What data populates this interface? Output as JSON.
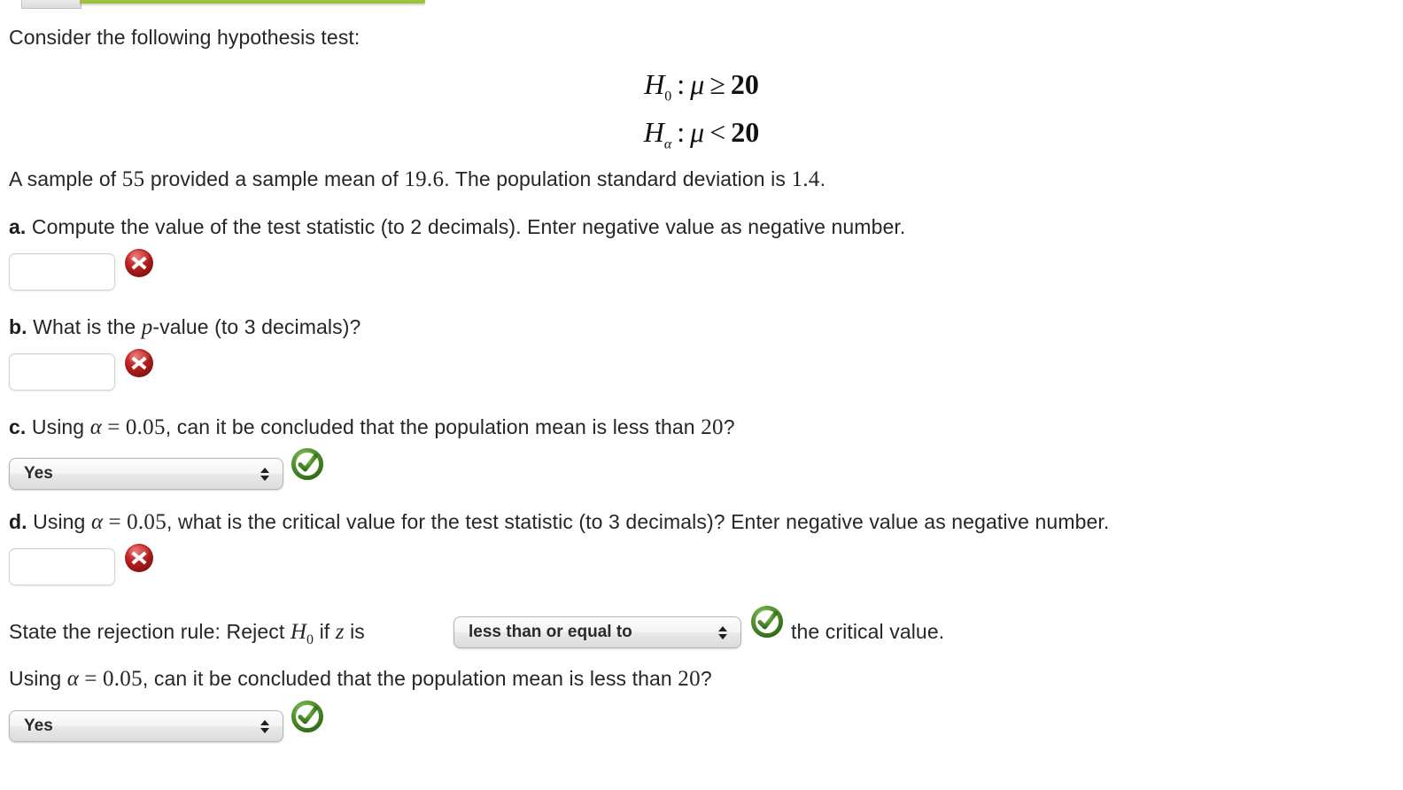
{
  "top": {
    "tab_label": "",
    "progress_bar_color": "#a7c943"
  },
  "intro": {
    "text": "Consider the following hypothesis test:"
  },
  "hypotheses": [
    {
      "symbol": "H",
      "subscript": "0",
      "colon": ":",
      "parameter": "μ",
      "operator": "≥",
      "value": "20"
    },
    {
      "symbol": "H",
      "subscript": "α",
      "colon": ":",
      "parameter": "μ",
      "operator": "<",
      "value": "20"
    }
  ],
  "sample_info": {
    "prefix": "A sample of ",
    "sample_size": "55",
    "middle": " provided a sample mean of ",
    "sample_mean": "19.6",
    "middle2": ". The population standard deviation is ",
    "std_dev": "1.4",
    "suffix": "."
  },
  "parts": {
    "a": {
      "label": "a.",
      "question": " Compute the value of the test statistic (to 2 decimals). Enter negative value as negative number.",
      "input_value": "",
      "input_placeholder": "",
      "status": "incorrect"
    },
    "b": {
      "label": "b.",
      "q_pre": " What is the ",
      "p_symbol": "p",
      "q_post": "-value (to 3 decimals)?",
      "input_value": "",
      "input_placeholder": "",
      "status": "incorrect"
    },
    "c": {
      "label": "c.",
      "q_pre": " Using ",
      "alpha": "α",
      "equals": " = ",
      "alpha_value": "0.05",
      "q_post": ", can it be concluded that the population mean is less than ",
      "mean_value": "20",
      "q_end": "?",
      "select_value": "Yes",
      "status": "correct"
    },
    "d": {
      "label": "d.",
      "q_pre": " Using ",
      "alpha": "α",
      "equals": " = ",
      "alpha_value": "0.05",
      "q_post": ", what is the critical value for the test statistic (to 3 decimals)? Enter negative value as negative number.",
      "input_value": "",
      "input_placeholder": "",
      "status": "incorrect"
    }
  },
  "rejection_rule": {
    "pre": "State the rejection rule: Reject ",
    "h_symbol": "H",
    "h_sub": "0",
    "mid": " if ",
    "z_symbol": "z",
    "post": " is ",
    "select_value": "less than or equal to",
    "status": "correct",
    "tail": "the critical value."
  },
  "final_question": {
    "q_pre": "Using ",
    "alpha": "α",
    "equals": " = ",
    "alpha_value": "0.05",
    "q_post": ", can it be concluded that the population mean is less than ",
    "mean_value": "20",
    "q_end": "?",
    "select_value": "Yes",
    "status": "correct"
  },
  "colors": {
    "incorrect_red": "#b01717",
    "correct_green": "#4a8c24",
    "progress_green": "#a7c943"
  },
  "icons": {
    "incorrect": "x-circle-icon",
    "correct": "check-circle-icon"
  }
}
